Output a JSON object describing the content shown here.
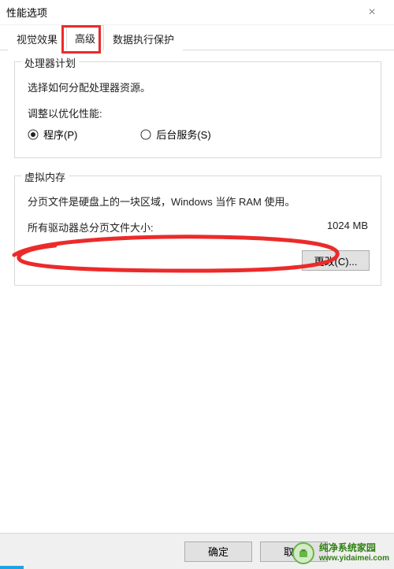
{
  "window": {
    "title": "性能选项"
  },
  "tabs": {
    "visual_effects": "视觉效果",
    "advanced": "高级",
    "dep": "数据执行保护"
  },
  "processor": {
    "group_title": "处理器计划",
    "desc": "选择如何分配处理器资源。",
    "adjust_label": "调整以优化性能:",
    "radio_program": "程序(P)",
    "radio_background": "后台服务(S)"
  },
  "vm": {
    "group_title": "虚拟内存",
    "desc": "分页文件是硬盘上的一块区域，Windows 当作 RAM 使用。",
    "size_label": "所有驱动器总分页文件大小:",
    "size_value": "1024 MB",
    "change_btn": "更改(C)..."
  },
  "footer": {
    "ok": "确定",
    "cancel": "取消"
  },
  "watermark": {
    "cn": "纯净系统家园",
    "url": "www.yidaimei.com"
  }
}
